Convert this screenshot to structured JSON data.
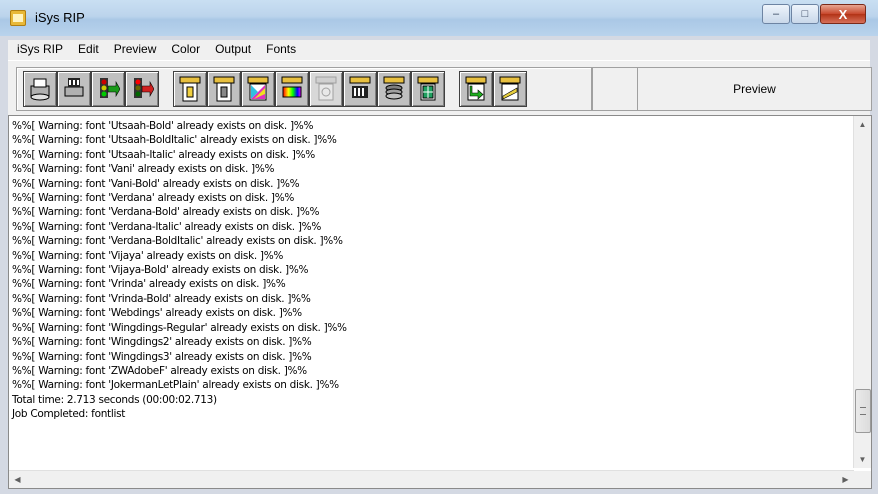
{
  "window": {
    "title": "iSys RIP",
    "caption": {
      "minimize": "–",
      "maximize": "□",
      "close": "X"
    }
  },
  "menu": [
    "iSys RIP",
    "Edit",
    "Preview",
    "Color",
    "Output",
    "Fonts"
  ],
  "toolbar": {
    "buttons": [
      {
        "name": "printer-icon"
      },
      {
        "name": "film-printer-icon"
      },
      {
        "name": "traffic-light-green-icon"
      },
      {
        "name": "traffic-light-red-icon"
      },
      {
        "name": "document-properties-icon"
      },
      {
        "name": "page-setup-icon"
      },
      {
        "name": "color-palette-icon"
      },
      {
        "name": "color-bars-icon"
      },
      {
        "name": "disabled-tool-icon"
      },
      {
        "name": "film-strip-icon"
      },
      {
        "name": "disk-stack-icon"
      },
      {
        "name": "grid-layout-icon"
      },
      {
        "name": "green-arrow-icon"
      },
      {
        "name": "ruler-icon"
      }
    ],
    "preview_label": "Preview"
  },
  "log": {
    "lines": [
      "%%[ Warning: font 'Utsaah-Bold' already exists on disk. ]%%",
      "%%[ Warning: font 'Utsaah-BoldItalic' already exists on disk. ]%%",
      "%%[ Warning: font 'Utsaah-Italic' already exists on disk. ]%%",
      "%%[ Warning: font 'Vani' already exists on disk. ]%%",
      "%%[ Warning: font 'Vani-Bold' already exists on disk. ]%%",
      "%%[ Warning: font 'Verdana' already exists on disk. ]%%",
      "%%[ Warning: font 'Verdana-Bold' already exists on disk. ]%%",
      "%%[ Warning: font 'Verdana-Italic' already exists on disk. ]%%",
      "%%[ Warning: font 'Verdana-BoldItalic' already exists on disk. ]%%",
      "%%[ Warning: font 'Vijaya' already exists on disk. ]%%",
      "%%[ Warning: font 'Vijaya-Bold' already exists on disk. ]%%",
      "%%[ Warning: font 'Vrinda' already exists on disk. ]%%",
      "%%[ Warning: font 'Vrinda-Bold' already exists on disk. ]%%",
      "%%[ Warning: font 'Webdings' already exists on disk. ]%%",
      "%%[ Warning: font 'Wingdings-Regular' already exists on disk. ]%%",
      "%%[ Warning: font 'Wingdings2' already exists on disk. ]%%",
      "%%[ Warning: font 'Wingdings3' already exists on disk. ]%%",
      "%%[ Warning: font 'ZWAdobeF' already exists on disk. ]%%",
      "%%[ Warning: font 'JokermanLetPlain' already exists on disk. ]%%",
      "Total time: 2.713 seconds (00:00:02.713)",
      "Job Completed: fontlist"
    ]
  },
  "scroll": {
    "up": "▲",
    "down": "▼",
    "left": "◀",
    "right": "▶"
  }
}
